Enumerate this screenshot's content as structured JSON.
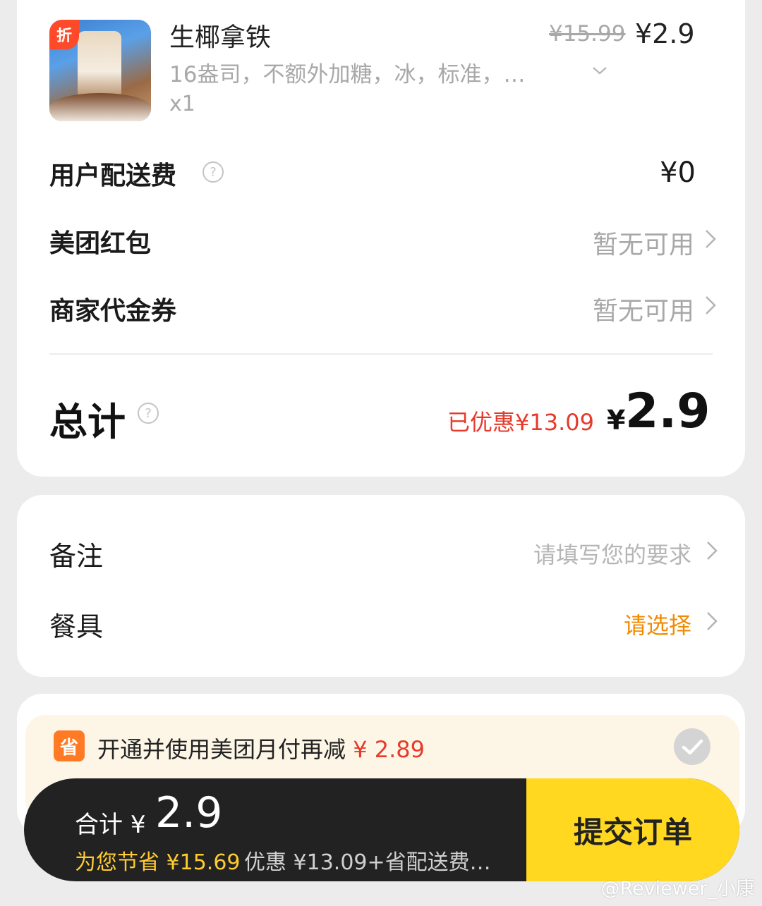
{
  "order": {
    "product": {
      "badge": "折",
      "name": "生椰拿铁",
      "spec": "16盎司，不额外加糖，冰，标准，…",
      "qty": "x1",
      "price_old": "¥15.99",
      "price_now": "¥2.9"
    },
    "delivery_fee": {
      "label": "用户配送费",
      "value": "¥0"
    },
    "red_packet": {
      "label": "美团红包",
      "value": "暂无可用"
    },
    "voucher": {
      "label": "商家代金券",
      "value": "暂无可用"
    },
    "total": {
      "label": "总计",
      "saved": "已优惠¥13.09",
      "currency": "¥",
      "amount": "2.9"
    }
  },
  "notes": {
    "remark": {
      "label": "备注",
      "placeholder": "请填写您的要求"
    },
    "utensils": {
      "label": "餐具",
      "value": "请选择"
    }
  },
  "promo": {
    "icon_text": "省",
    "text": "开通并使用美团月付再减",
    "amount": "¥ 2.89"
  },
  "bottom_bar": {
    "sum_label": "合计",
    "sum_currency": "¥",
    "sum_amount": "2.9",
    "save_text": "为您节省 ¥15.69",
    "save_detail": "优惠 ¥13.09+省配送费…",
    "submit_label": "提交订单"
  },
  "watermark": "@Reviewer_小康",
  "colors": {
    "accent_red": "#e8392b",
    "accent_orange": "#ff7a24",
    "submit_yellow": "#ffd81f",
    "bar_dark": "#222222"
  }
}
